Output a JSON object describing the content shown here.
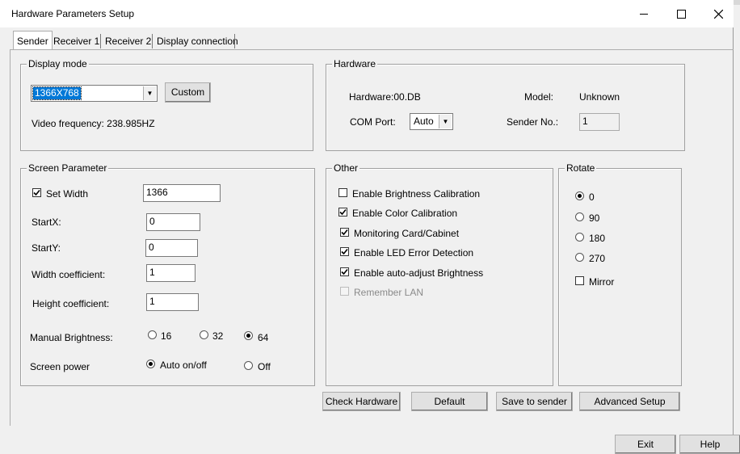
{
  "window": {
    "title": "Hardware Parameters Setup"
  },
  "tabs": [
    "Sender",
    "Receiver 1",
    "Receiver 2",
    "Display connection"
  ],
  "display_mode": {
    "group_label": "Display mode",
    "resolution": "1366X768",
    "custom_label": "Custom",
    "video_frequency": "Video frequency: 238.985HZ"
  },
  "hardware": {
    "group_label": "Hardware",
    "hardware_text": "Hardware:00.DB",
    "model_label": "Model:",
    "model_value": "Unknown",
    "com_port_label": "COM Port:",
    "com_port_value": "Auto",
    "sender_no_label": "Sender No.:",
    "sender_no_value": "1"
  },
  "screen_parameter": {
    "group_label": "Screen Parameter",
    "set_width_label": "Set Width",
    "set_width_checked": true,
    "width_value": "1366",
    "startx_label": "StartX:",
    "startx_value": "0",
    "starty_label": "StartY:",
    "starty_value": "0",
    "width_coef_label": "Width coefficient:",
    "width_coef_value": "1",
    "height_coef_label": "Height coefficient:",
    "height_coef_value": "1",
    "brightness_label": "Manual Brightness:",
    "brightness_options": [
      "16",
      "32",
      "64"
    ],
    "brightness_selected": "64",
    "power_label": "Screen power",
    "power_options": [
      "Auto on/off",
      "Off"
    ],
    "power_selected": "Auto on/off"
  },
  "other": {
    "group_label": "Other",
    "items": [
      {
        "label": "Enable Brightness Calibration",
        "checked": false,
        "enabled": true
      },
      {
        "label": "Enable Color Calibration",
        "checked": true,
        "enabled": true
      },
      {
        "label": "Monitoring Card/Cabinet",
        "checked": true,
        "enabled": true
      },
      {
        "label": "Enable LED Error Detection",
        "checked": true,
        "enabled": true
      },
      {
        "label": "Enable auto-adjust Brightness",
        "checked": true,
        "enabled": true
      },
      {
        "label": "Remember LAN",
        "checked": false,
        "enabled": false
      }
    ]
  },
  "rotate": {
    "group_label": "Rotate",
    "options": [
      "0",
      "90",
      "180",
      "270"
    ],
    "selected": "0",
    "mirror_label": "Mirror",
    "mirror_checked": false
  },
  "actions": {
    "check_hardware": "Check Hardware",
    "default": "Default",
    "save_to_sender": "Save to sender",
    "advanced_setup": "Advanced Setup"
  },
  "footer": {
    "exit": "Exit",
    "help": "Help"
  },
  "icons": {
    "minimize": "minimize-icon",
    "maximize": "maximize-icon",
    "close": "close-icon",
    "dropdown": "chevron-down-icon",
    "check": "checkmark-icon"
  }
}
